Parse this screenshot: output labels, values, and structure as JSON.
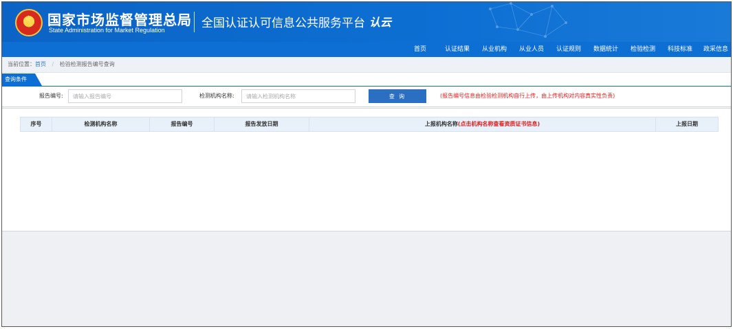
{
  "header": {
    "title_cn": "国家市场监督管理总局",
    "title_en": "State Administration for Market Regulation",
    "platform": "全国认证认可信息公共服务平台",
    "platform_logo_text": "认云",
    "emblem_icon": "national-emblem-icon",
    "background_color": "#0b63c5"
  },
  "nav": {
    "items": [
      "首页",
      "认证结果",
      "从业机构",
      "从业人员",
      "认证规则",
      "数据统计",
      "检验检测",
      "科技标准",
      "政采信息"
    ]
  },
  "breadcrumb": {
    "prefix": "当前位置：",
    "home": "首页",
    "separator": "/",
    "current": "检验检测报告编号查询"
  },
  "query": {
    "tab_label": "查询条件",
    "report_label": "报告编号:",
    "report_placeholder": "请输入报告编号",
    "org_label": "检测机构名称:",
    "org_placeholder": "请输入检测机构名称",
    "search_label": "查 询",
    "notice": "(报告编号信息由检验检测机构自行上传，由上传机构对内容真实性负责)"
  },
  "table": {
    "columns": [
      "序号",
      "检测机构名称",
      "报告编号",
      "报告发放日期",
      "上报机构名称",
      "上报日期"
    ],
    "upload_org_hint": "(点击机构名称查看资质证书信息)"
  },
  "colors": {
    "accent": "#0d6fd3",
    "button": "#2a6fc2",
    "notice": "#e02020"
  }
}
